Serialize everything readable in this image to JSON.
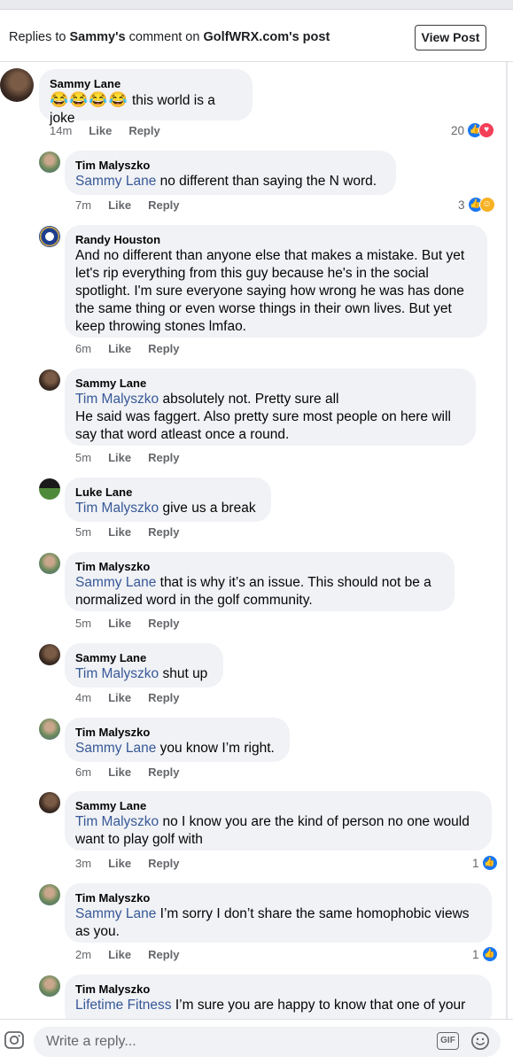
{
  "header": {
    "title_prefix": "Replies to ",
    "title_person": "Sammy's",
    "title_middle": " comment on ",
    "title_page": "GolfWRX.com",
    "title_suffix": "'s post",
    "view_post_label": "View Post"
  },
  "actions": {
    "like": "Like",
    "reply": "Reply"
  },
  "comments": [
    {
      "name": "Sammy Lane",
      "emoji": "😂😂😂😂",
      "text": " this world is a joke",
      "time": "14m",
      "reaction_count": "20"
    },
    {
      "name": "Tim Malyszko",
      "mention": "Sammy Lane",
      "text": " no different than saying the N word.",
      "time": "7m",
      "reaction_count": "3"
    },
    {
      "name": "Randy Houston",
      "lines": [
        "And no different than anyone else that makes a mistake. But yet",
        "let's rip everything from this guy because he's in the social",
        "spotlight. I'm sure everyone saying how wrong he was has done",
        "the same thing or even worse things in their own lives. But yet",
        "keep throwing stones lmfao."
      ],
      "time": "6m"
    },
    {
      "name": "Sammy Lane",
      "mention": "Tim Malyszko",
      "text": " absolutely not. Pretty sure all",
      "lines": [
        "He said was faggert. Also pretty sure most people on here will",
        "say that word atleast once a round."
      ],
      "time": "5m"
    },
    {
      "name": "Luke Lane",
      "mention": "Tim Malyszko",
      "text": " give us a break",
      "time": "5m"
    },
    {
      "name": "Tim Malyszko",
      "mention": "Sammy Lane",
      "text": " that is why it’s an issue.  This should not be a",
      "lines": [
        "normalized word in the golf community."
      ],
      "time": "5m"
    },
    {
      "name": "Sammy Lane",
      "mention": "Tim Malyszko",
      "text": " shut up",
      "time": "4m"
    },
    {
      "name": "Tim Malyszko",
      "mention": "Sammy Lane",
      "text": " you know I’m right.",
      "time": "6m"
    },
    {
      "name": "Sammy Lane",
      "mention": "Tim Malyszko",
      "text": " no I know you are the kind of person no one would",
      "lines": [
        "want to play golf with"
      ],
      "time": "3m",
      "reaction_count": "1"
    },
    {
      "name": "Tim Malyszko",
      "mention": "Sammy Lane",
      "text": " I’m sorry I don’t share the same homophobic views",
      "lines": [
        "as you."
      ],
      "time": "2m",
      "reaction_count": "1"
    },
    {
      "name": "Tim Malyszko",
      "mention": "Lifetime Fitness",
      "text": " I’m sure you are happy to know that one of your"
    }
  ],
  "composer": {
    "placeholder": "Write a reply...",
    "gif_label": "GIF"
  },
  "icons": {
    "camera": "camera-icon",
    "gif": "gif-icon",
    "emoji": "emoji-icon",
    "like": "like-reaction-icon",
    "love": "love-reaction-icon",
    "haha": "haha-reaction-icon"
  },
  "colors": {
    "mention": "#385898",
    "bubble": "#f0f2f5",
    "like_blue": "#1877f2",
    "love_red": "#f33e58",
    "haha_yellow": "#f7b125"
  }
}
